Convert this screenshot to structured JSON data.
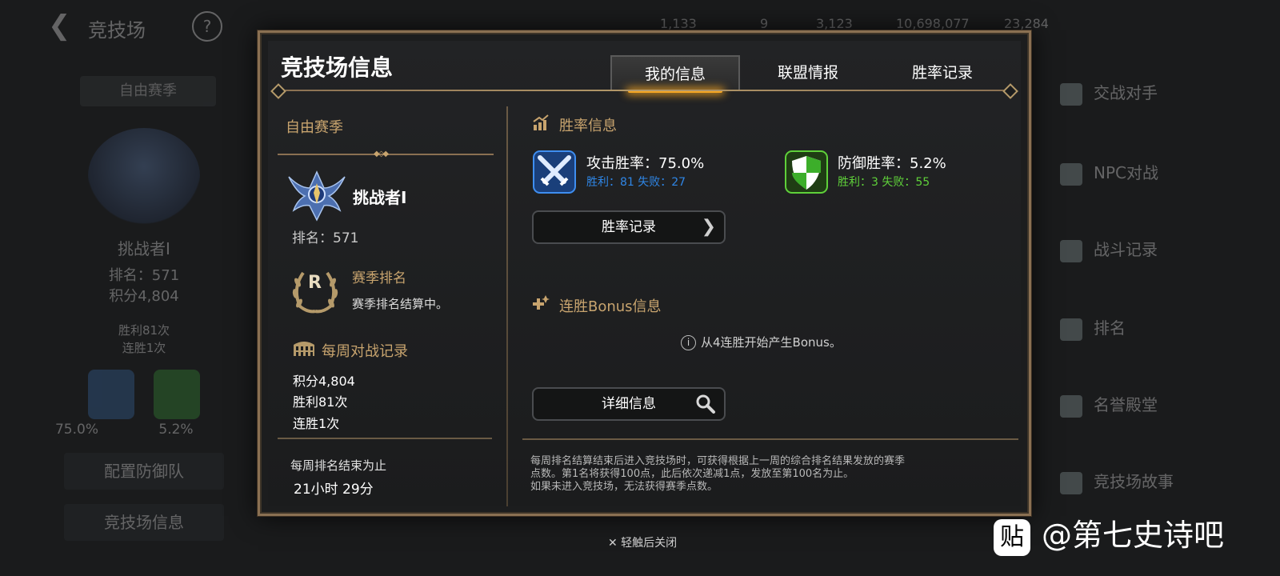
{
  "background": {
    "title": "竞技场",
    "currencies": [
      "1,133",
      "9",
      "3,123",
      "10,698,077",
      "23,284"
    ],
    "season_tab": "自由赛季",
    "rank_name": "挑战者I",
    "rank_pos": "排名：571",
    "score": "积分4,804",
    "wins": "胜利81次",
    "streak": "连胜1次",
    "atk_pct": "75.0%",
    "def_pct": "5.2%",
    "btn_defense": "配置防御队",
    "btn_info": "竞技场信息",
    "right_menu": [
      "交战对手",
      "NPC对战",
      "战斗记录",
      "排名",
      "名誉殿堂",
      "竞技场故事"
    ]
  },
  "modal": {
    "title": "竞技场信息",
    "tabs": [
      {
        "label": "我的信息",
        "active": true
      },
      {
        "label": "联盟情报",
        "active": false
      },
      {
        "label": "胜率记录",
        "active": false
      }
    ],
    "left": {
      "season_title": "自由赛季",
      "rank_name": "挑战者I",
      "rank_position": "排名：571",
      "season_rank_title": "赛季排名",
      "season_rank_badge": "R",
      "season_rank_desc": "赛季排名结算中。",
      "weekly_title": "每周对战记录",
      "weekly_lines": [
        "积分4,804",
        "胜利81次",
        "连胜1次"
      ],
      "weekly_end_label": "每周排名结束为止",
      "weekly_end_value": "21小时 29分"
    },
    "right": {
      "winrate_title": "胜率信息",
      "attack": {
        "title": "攻击胜率：75.0%",
        "sub": "胜利：81 失败：27",
        "color": "#2f86e6"
      },
      "defense": {
        "title": "防御胜率：5.2%",
        "sub": "胜利：3 失败：55",
        "color": "#5fd13a"
      },
      "winrate_record_button": "胜率记录",
      "bonus_title": "连胜Bonus信息",
      "bonus_info": "从4连胜开始产生Bonus。",
      "detail_button": "详细信息",
      "footnote_lines": [
        "每周排名结算结束后进入竞技场时，可获得根据上一周的综合排名结果发放的赛季",
        "点数。第1名将获得100点，此后依次递减1点，发放至第100名为止。",
        "如果未进入竞技场，无法获得赛季点数。"
      ]
    }
  },
  "close_hint": "✕ 轻触后关闭",
  "watermark": {
    "logo": "贴",
    "text": "@第七史诗吧"
  },
  "colors": {
    "accent_gold": "#c8a46e",
    "tab_glow": "#f5a623",
    "frame": "#8a7052"
  }
}
